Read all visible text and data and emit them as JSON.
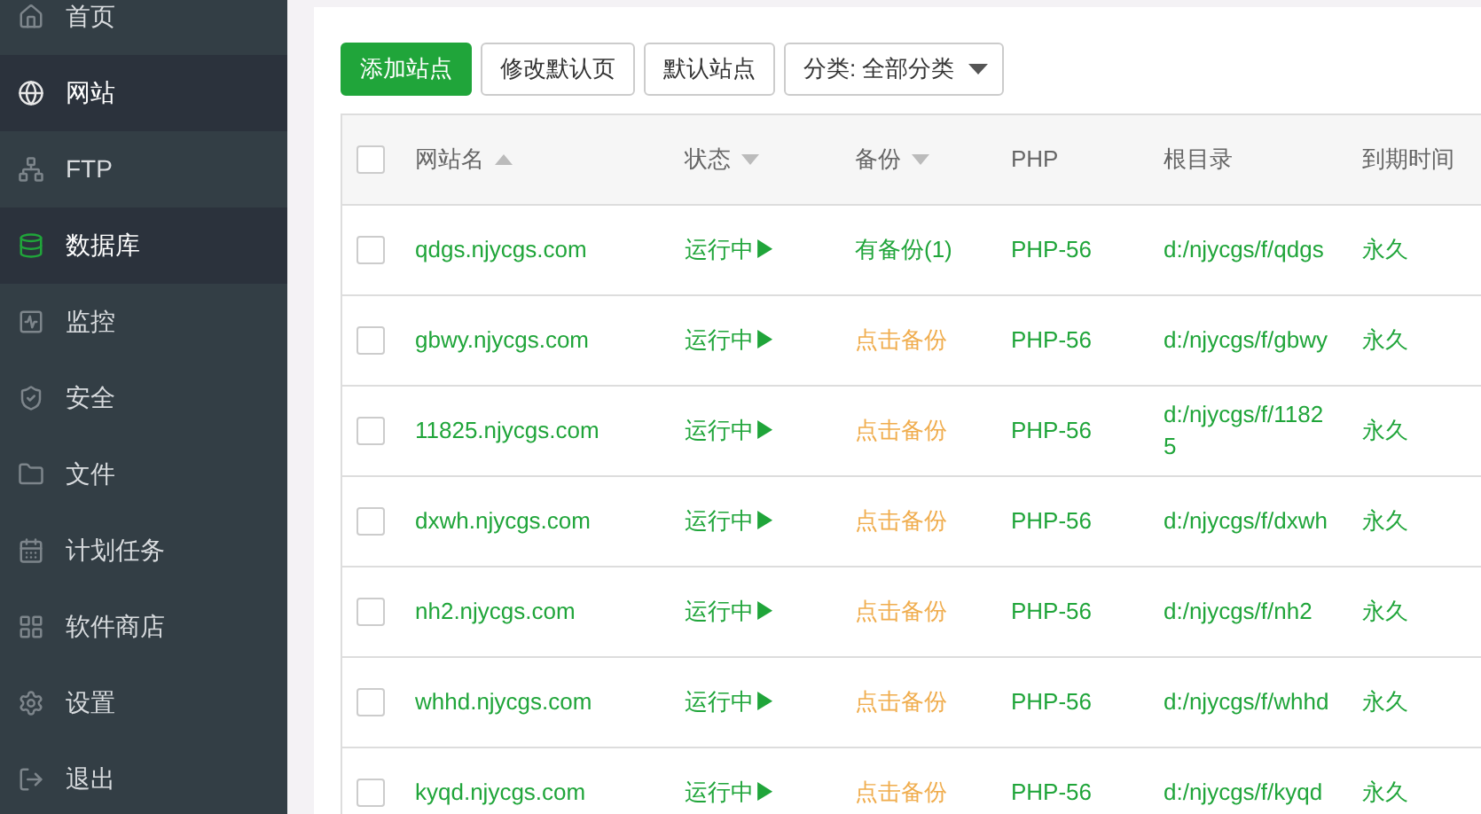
{
  "sidebar": {
    "items": [
      {
        "label": "首页",
        "selected": false
      },
      {
        "label": "网站",
        "selected": true
      },
      {
        "label": "FTP",
        "selected": false
      },
      {
        "label": "数据库",
        "selected": true,
        "icon_highlight": true
      },
      {
        "label": "监控",
        "selected": false
      },
      {
        "label": "安全",
        "selected": false
      },
      {
        "label": "文件",
        "selected": false
      },
      {
        "label": "计划任务",
        "selected": false
      },
      {
        "label": "软件商店",
        "selected": false
      },
      {
        "label": "设置",
        "selected": false
      },
      {
        "label": "退出",
        "selected": false
      }
    ]
  },
  "toolbar": {
    "buttons": [
      {
        "label": "添加站点",
        "kind": "primary"
      },
      {
        "label": "修改默认页",
        "kind": "default"
      },
      {
        "label": "默认站点",
        "kind": "default"
      }
    ],
    "category_select": {
      "value": "分类: 全部分类"
    }
  },
  "table": {
    "select_all_checked": false,
    "columns": [
      {
        "label": "网站名",
        "sortable": true,
        "ascending": true
      },
      {
        "label": "状态",
        "sortable": true,
        "ascending": false
      },
      {
        "label": "备份",
        "sortable": true,
        "ascending": false
      },
      {
        "label": "PHP",
        "sortable": false
      },
      {
        "label": "根目录",
        "sortable": false
      },
      {
        "label": "到期时间",
        "sortable": false
      }
    ],
    "rows": [
      {
        "checked": false,
        "name": "qdgs.njycgs.com",
        "status": "运行中▶",
        "backup": "有备份(1)",
        "has_backup": true,
        "php": "PHP-56",
        "root": "d:/njycgs/f/qdgs",
        "expiry": "永久"
      },
      {
        "checked": false,
        "name": "gbwy.njycgs.com",
        "status": "运行中▶",
        "backup": "点击备份",
        "has_backup": false,
        "php": "PHP-56",
        "root": "d:/njycgs/f/gbwy",
        "expiry": "永久"
      },
      {
        "checked": false,
        "name": "11825.njycgs.com",
        "status": "运行中▶",
        "backup": "点击备份",
        "has_backup": false,
        "php": "PHP-56",
        "root": "d:/njycgs/f/11825",
        "expiry": "永久"
      },
      {
        "checked": false,
        "name": "dxwh.njycgs.com",
        "status": "运行中▶",
        "backup": "点击备份",
        "has_backup": false,
        "php": "PHP-56",
        "root": "d:/njycgs/f/dxwh",
        "expiry": "永久"
      },
      {
        "checked": false,
        "name": "nh2.njycgs.com",
        "status": "运行中▶",
        "backup": "点击备份",
        "has_backup": false,
        "php": "PHP-56",
        "root": "d:/njycgs/f/nh2",
        "expiry": "永久"
      },
      {
        "checked": false,
        "name": "whhd.njycgs.com",
        "status": "运行中▶",
        "backup": "点击备份",
        "has_backup": false,
        "php": "PHP-56",
        "root": "d:/njycgs/f/whhd",
        "expiry": "永久"
      },
      {
        "checked": false,
        "name": "kyqd.njycgs.com",
        "status": "运行中▶",
        "backup": "点击备份",
        "has_backup": false,
        "php": "PHP-56",
        "root": "d:/njycgs/f/kyqd",
        "expiry": "永久"
      }
    ]
  }
}
